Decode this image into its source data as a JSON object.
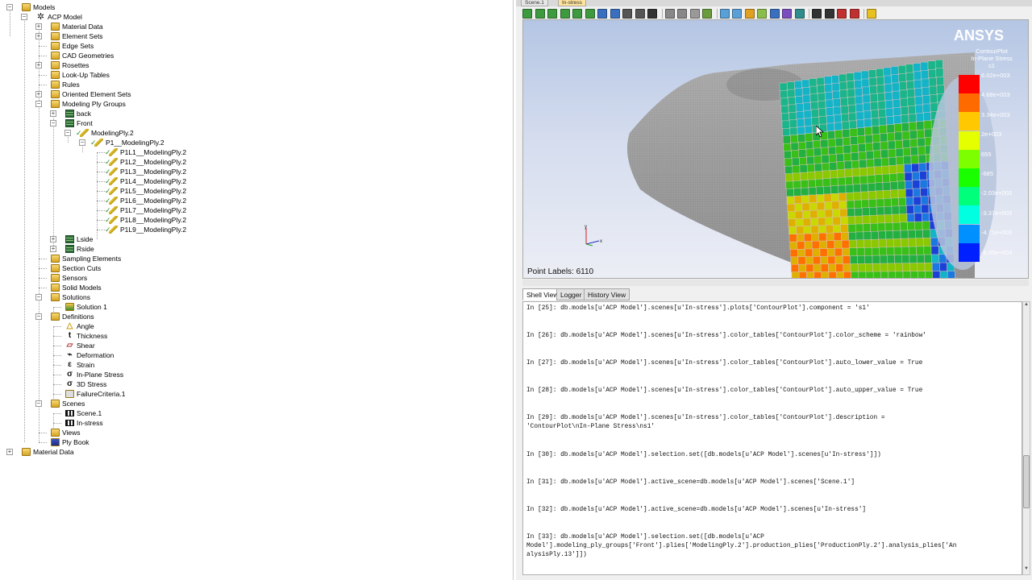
{
  "tree": {
    "items": [
      {
        "label": "Models",
        "level": 1,
        "icon": "folder-icon",
        "expander": "-"
      },
      {
        "label": "ACP Model",
        "level": 2,
        "icon": "gear-icon",
        "expander": "-"
      },
      {
        "label": "Material Data",
        "level": 3,
        "icon": "folder-icon",
        "expander": "+"
      },
      {
        "label": "Element Sets",
        "level": 3,
        "icon": "folder-icon",
        "expander": "+"
      },
      {
        "label": "Edge Sets",
        "level": 3,
        "icon": "folder-icon",
        "expander": ""
      },
      {
        "label": "CAD Geometries",
        "level": 3,
        "icon": "folder-icon",
        "expander": ""
      },
      {
        "label": "Rosettes",
        "level": 3,
        "icon": "folder-icon",
        "expander": "+"
      },
      {
        "label": "Look-Up Tables",
        "level": 3,
        "icon": "folder-icon",
        "expander": ""
      },
      {
        "label": "Rules",
        "level": 3,
        "icon": "folder-icon",
        "expander": ""
      },
      {
        "label": "Oriented Element Sets",
        "level": 3,
        "icon": "folder-icon",
        "expander": "+"
      },
      {
        "label": "Modeling Ply Groups",
        "level": 3,
        "icon": "folder-icon",
        "expander": "-"
      },
      {
        "label": "back",
        "level": 4,
        "icon": "ply-stack-icon",
        "expander": "+"
      },
      {
        "label": "Front",
        "level": 4,
        "icon": "ply-stack-icon",
        "expander": "-"
      },
      {
        "label": "ModelingPly.2",
        "level": 5,
        "icon": "modeling-ply-icon",
        "expander": "-"
      },
      {
        "label": "P1__ModelingPly.2",
        "level": 6,
        "icon": "production-ply-icon",
        "expander": "-"
      },
      {
        "label": "P1L1__ModelingPly.2",
        "level": 7,
        "icon": "analysis-ply-icon",
        "expander": ""
      },
      {
        "label": "P1L2__ModelingPly.2",
        "level": 7,
        "icon": "analysis-ply-icon",
        "expander": ""
      },
      {
        "label": "P1L3__ModelingPly.2",
        "level": 7,
        "icon": "analysis-ply-icon",
        "expander": ""
      },
      {
        "label": "P1L4__ModelingPly.2",
        "level": 7,
        "icon": "analysis-ply-icon",
        "expander": ""
      },
      {
        "label": "P1L5__ModelingPly.2",
        "level": 7,
        "icon": "analysis-ply-icon",
        "expander": ""
      },
      {
        "label": "P1L6__ModelingPly.2",
        "level": 7,
        "icon": "analysis-ply-icon",
        "expander": ""
      },
      {
        "label": "P1L7__ModelingPly.2",
        "level": 7,
        "icon": "analysis-ply-icon",
        "expander": ""
      },
      {
        "label": "P1L8__ModelingPly.2",
        "level": 7,
        "icon": "analysis-ply-icon",
        "expander": ""
      },
      {
        "label": "P1L9__ModelingPly.2",
        "level": 7,
        "icon": "analysis-ply-icon",
        "expander": ""
      },
      {
        "label": "Lside",
        "level": 4,
        "icon": "ply-stack-icon",
        "expander": "+"
      },
      {
        "label": "Rside",
        "level": 4,
        "icon": "ply-stack-icon",
        "expander": "+"
      },
      {
        "label": "Sampling Elements",
        "level": 3,
        "icon": "folder-icon",
        "expander": ""
      },
      {
        "label": "Section Cuts",
        "level": 3,
        "icon": "folder-icon",
        "expander": ""
      },
      {
        "label": "Sensors",
        "level": 3,
        "icon": "folder-icon",
        "expander": ""
      },
      {
        "label": "Solid Models",
        "level": 3,
        "icon": "folder-icon",
        "expander": ""
      },
      {
        "label": "Solutions",
        "level": 3,
        "icon": "folder-icon",
        "expander": "-"
      },
      {
        "label": "Solution 1",
        "level": 4,
        "icon": "solution-icon",
        "expander": ""
      },
      {
        "label": "Definitions",
        "level": 3,
        "icon": "folder-icon",
        "expander": "-"
      },
      {
        "label": "Angle",
        "level": 4,
        "icon": "angle-icon",
        "expander": ""
      },
      {
        "label": "Thickness",
        "level": 4,
        "icon": "thickness-icon",
        "expander": ""
      },
      {
        "label": "Shear",
        "level": 4,
        "icon": "shear-icon",
        "expander": ""
      },
      {
        "label": "Deformation",
        "level": 4,
        "icon": "deformation-icon",
        "expander": ""
      },
      {
        "label": "Strain",
        "level": 4,
        "icon": "strain-icon",
        "expander": ""
      },
      {
        "label": "In-Plane Stress",
        "level": 4,
        "icon": "stress-icon",
        "expander": ""
      },
      {
        "label": "3D Stress",
        "level": 4,
        "icon": "stress-icon",
        "expander": ""
      },
      {
        "label": "FailureCriteria.1",
        "level": 4,
        "icon": "failure-criteria-icon",
        "expander": ""
      },
      {
        "label": "Scenes",
        "level": 3,
        "icon": "folder-icon",
        "expander": "-"
      },
      {
        "label": "Scene.1",
        "level": 4,
        "icon": "clapperboard-icon",
        "expander": ""
      },
      {
        "label": "In-stress",
        "level": 4,
        "icon": "clapperboard-icon",
        "expander": ""
      },
      {
        "label": "Views",
        "level": 3,
        "icon": "folder-icon",
        "expander": ""
      },
      {
        "label": "Ply Book",
        "level": 3,
        "icon": "ply-book-icon",
        "expander": ""
      },
      {
        "label": "Material Data",
        "level": 1,
        "icon": "folder-icon",
        "expander": "+"
      }
    ]
  },
  "doc_tabs": [
    {
      "label": "Scene.1",
      "active": false
    },
    {
      "label": "In-stress",
      "active": true
    }
  ],
  "viewport": {
    "logo": "ANSYS",
    "legend_title_lines": [
      "ContourPlot",
      "In-Plane Stress",
      "s1"
    ],
    "legend_ticks": [
      "6.02e+003",
      "4.68e+003",
      "3.34e+003",
      "2e+003",
      "655",
      "-685",
      "-2.03e+003",
      "-3.37e+003",
      "-4.71e+003",
      "-6.05e+003"
    ],
    "legend_colors": [
      "#ff0000",
      "#ff6a00",
      "#ffc800",
      "#e6ff00",
      "#7dff00",
      "#1aff00",
      "#00ff7a",
      "#00ffe0",
      "#0090ff",
      "#0020ff"
    ],
    "point_labels": "Point Labels: 6110",
    "triad_labels": {
      "y": "y",
      "x": "x"
    }
  },
  "bottom_tabs": [
    {
      "label": "Shell View",
      "active": true
    },
    {
      "label": "Logger",
      "active": false
    },
    {
      "label": "History View",
      "active": false
    }
  ],
  "shell": {
    "lines": [
      "In [25]: db.models[u'ACP Model'].scenes[u'In-stress'].plots['ContourPlot'].component = 's1'",
      "In [26]: db.models[u'ACP Model'].scenes[u'In-stress'].color_tables['ContourPlot'].color_scheme = 'rainbow'",
      "In [27]: db.models[u'ACP Model'].scenes[u'In-stress'].color_tables['ContourPlot'].auto_lower_value = True",
      "In [28]: db.models[u'ACP Model'].scenes[u'In-stress'].color_tables['ContourPlot'].auto_upper_value = True",
      "In [29]: db.models[u'ACP Model'].scenes[u'In-stress'].color_tables['ContourPlot'].description =\n'ContourPlot\\nIn-Plane Stress\\ns1'",
      "In [30]: db.models[u'ACP Model'].selection.set([db.models[u'ACP Model'].scenes[u'In-stress']])",
      "In [31]: db.models[u'ACP Model'].active_scene=db.models[u'ACP Model'].scenes['Scene.1']",
      "In [32]: db.models[u'ACP Model'].active_scene=db.models[u'ACP Model'].scenes[u'In-stress']",
      "In [33]: db.models[u'ACP Model'].selection.set([db.models[u'ACP\nModel'].modeling_ply_groups['Front'].plies['ModelingPly.2'].production_plies['ProductionPly.2'].analysis_plies['An\nalysisPly.13']])"
    ]
  }
}
